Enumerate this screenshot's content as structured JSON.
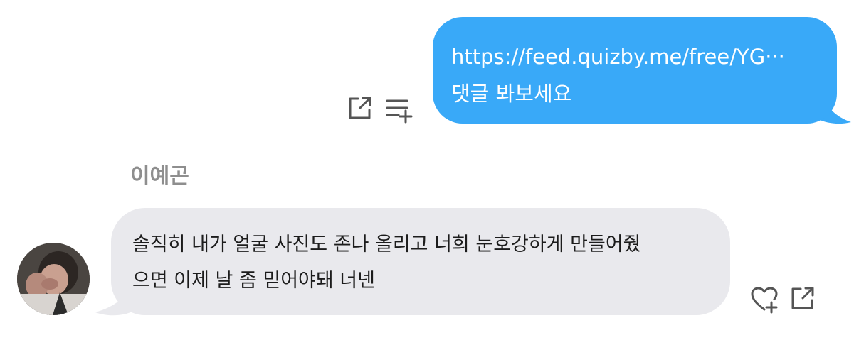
{
  "outgoing_message": {
    "line1": "https://feed.quizby.me/free/YG···",
    "line2": "댓글 봐보세요",
    "bubble_color": "#39a9f8",
    "text_color": "#ffffff",
    "actions": {
      "share_icon": "share-icon",
      "add_to_list_icon": "add-to-list-icon"
    }
  },
  "incoming_message": {
    "sender_name": "이예곤",
    "line1": "솔직히 내가 얼굴 사진도 존나 올리고 너희 눈호강하게 만들어줬",
    "line2": "으면 이제 날 좀 믿어야돼 너넨",
    "bubble_color": "#e9e9ed",
    "text_color": "#1c1c1c",
    "actions": {
      "like_icon": "heart-plus-icon",
      "share_icon": "share-icon"
    }
  }
}
